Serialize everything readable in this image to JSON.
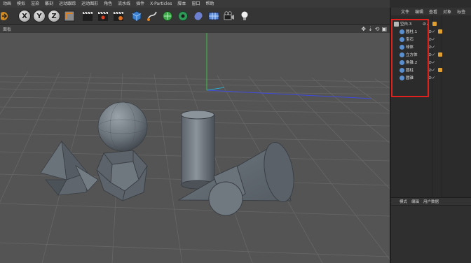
{
  "menubar": {
    "items": [
      "动画",
      "模拟",
      "渲染",
      "雕刻",
      "运动跟踪",
      "运动图形",
      "角色",
      "流水线",
      "插件",
      "X-Particles",
      "脚本",
      "窗口",
      "帮助"
    ]
  },
  "toolbar": {
    "axis_x": "X",
    "axis_y": "Y",
    "axis_z": "Z"
  },
  "viewport": {
    "label": "面板",
    "nav_icons": [
      "move-icon",
      "down-arrow-icon",
      "rotate-icon",
      "frame-icon"
    ]
  },
  "object_manager": {
    "tabs": [
      "文件",
      "编辑",
      "查看",
      "对象",
      "标签"
    ],
    "objects": [
      {
        "label": "空白.3"
      },
      {
        "label": "圆柱.1"
      },
      {
        "label": "宝石"
      },
      {
        "label": "球体"
      },
      {
        "label": "立方体"
      },
      {
        "label": "角锥.2"
      },
      {
        "label": "圆柱"
      },
      {
        "label": "圆锥"
      }
    ]
  },
  "attribute_manager": {
    "tabs": [
      "模式",
      "编辑",
      "用户数据"
    ]
  },
  "colors": {
    "highlight_box": "#e0201c",
    "viewport_bg": "#545454",
    "object_shading": "#6e7780"
  }
}
